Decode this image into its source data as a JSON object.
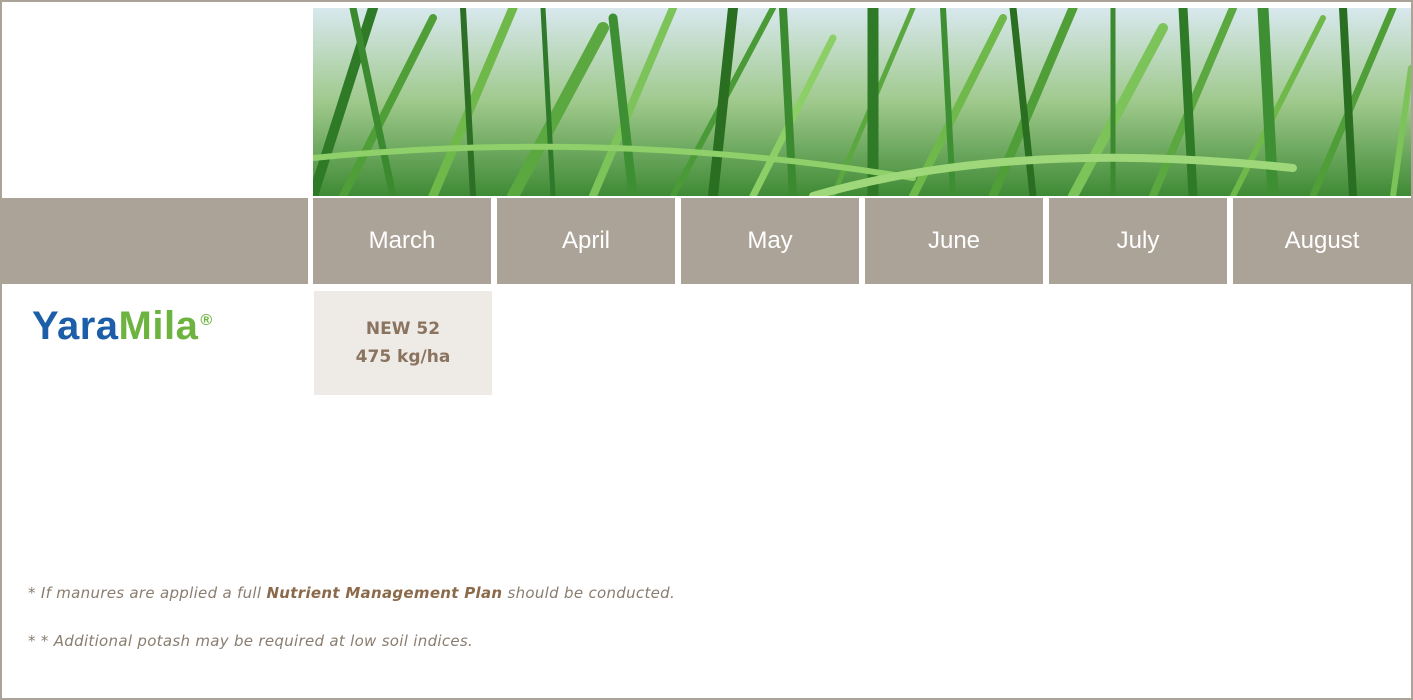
{
  "months": [
    "March",
    "April",
    "May",
    "June",
    "July",
    "August"
  ],
  "logo": {
    "part1": "Yara",
    "part2": "Mila",
    "registered": "®"
  },
  "application": {
    "product": "NEW 52",
    "rate": "475 kg/ha"
  },
  "notes": {
    "note1_prefix": "*  If manures are applied a full ",
    "note1_emphasis": "Nutrient Management Plan",
    "note1_suffix": " should be conducted.",
    "note2": "* *  Additional potash may be required at low soil indices."
  },
  "colors": {
    "month_bar": "#aca398",
    "yara_blue": "#1d5ea8",
    "mila_green": "#6cb33f",
    "application_bg": "#eeeae6",
    "application_text": "#8a7460"
  }
}
